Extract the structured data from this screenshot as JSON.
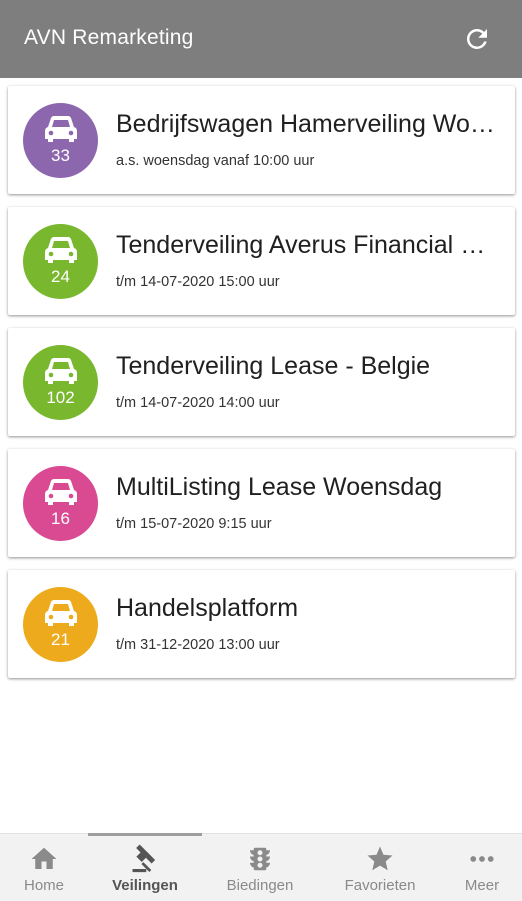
{
  "appbar": {
    "title": "AVN Remarketing",
    "refresh_icon": "refresh-icon"
  },
  "auctions": [
    {
      "name": "Bedrijfswagen Hamerveiling Woensdag",
      "when": "a.s. woensdag vanaf 10:00 uur",
      "count": "33",
      "color": "#8d67ae",
      "icon": "car-icon"
    },
    {
      "name": "Tenderveiling Averus Financial Services",
      "when": "t/m 14-07-2020 15:00 uur",
      "count": "24",
      "color": "#78b72e",
      "icon": "car-icon"
    },
    {
      "name": "Tenderveiling Lease - Belgie",
      "when": "t/m 14-07-2020 14:00 uur",
      "count": "102",
      "color": "#78b72e",
      "icon": "car-icon"
    },
    {
      "name": "MultiListing Lease Woensdag",
      "when": "t/m 15-07-2020 9:15 uur",
      "count": "16",
      "color": "#d94a92",
      "icon": "car-icon"
    },
    {
      "name": "Handelsplatform",
      "when": "t/m 31-12-2020 13:00 uur",
      "count": "21",
      "color": "#eeaa1d",
      "icon": "car-icon"
    }
  ],
  "nav": [
    {
      "label": "Home",
      "icon": "home-icon",
      "active": false
    },
    {
      "label": "Veilingen",
      "icon": "gavel-icon",
      "active": true
    },
    {
      "label": "Biedingen",
      "icon": "traffic-light-icon",
      "active": false
    },
    {
      "label": "Favorieten",
      "icon": "star-icon",
      "active": false
    },
    {
      "label": "Meer",
      "icon": "more-dots-icon",
      "active": false
    }
  ]
}
